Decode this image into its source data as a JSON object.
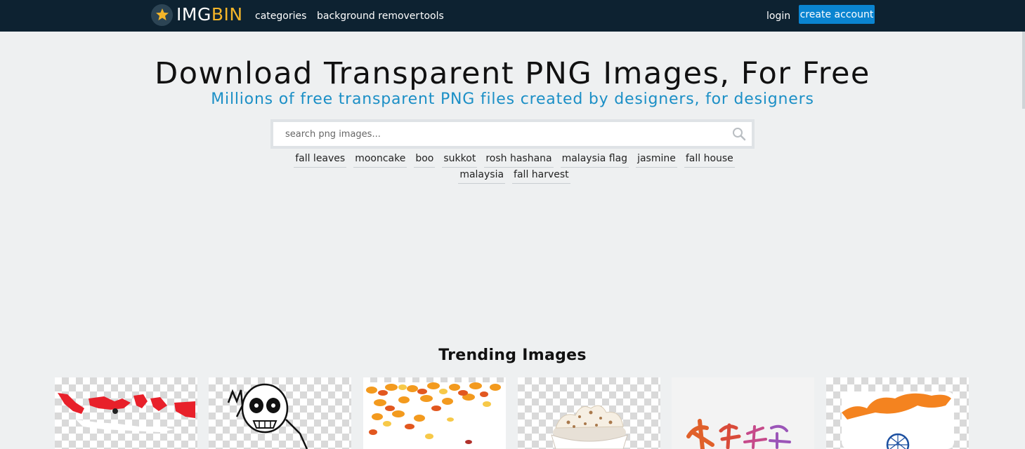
{
  "header": {
    "logo": {
      "part1": "IMG",
      "part2": "BIN"
    },
    "nav": [
      "categories",
      "background remover",
      "tools"
    ],
    "login": "login",
    "create_account": "create account"
  },
  "hero": {
    "title": "Download Transparent PNG Images, For Free",
    "subtitle": "Millions of free transparent PNG files created by designers, for designers"
  },
  "search": {
    "placeholder": "search png images..."
  },
  "tags": [
    "fall leaves",
    "mooncake",
    "boo",
    "sukkot",
    "rosh hashana",
    "malaysia flag",
    "jasmine",
    "fall house",
    "malaysia",
    "fall harvest"
  ],
  "trending": {
    "title": "Trending Images",
    "images": [
      "indonesia-map",
      "skeleton-cartoon",
      "autumn-leaves",
      "whipped-cream-cup",
      "chinese-calligraphy",
      "india-flag"
    ]
  },
  "colors": {
    "header_bg": "#0d2231",
    "accent": "#0a84d0",
    "subtitle": "#1b8fc6",
    "logo_bin": "#f4b529"
  }
}
